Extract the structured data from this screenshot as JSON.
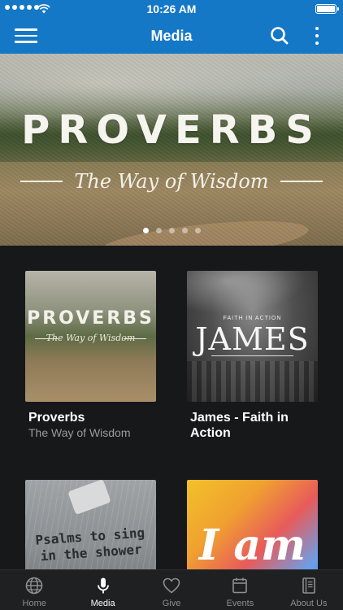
{
  "status_bar": {
    "time": "10:26 AM"
  },
  "app_bar": {
    "title": "Media"
  },
  "hero": {
    "title": "PROVERBS",
    "subtitle": "The Way of Wisdom",
    "carousel_pages": 5,
    "active_page": 1
  },
  "media": [
    {
      "title": "Proverbs",
      "subtitle": "The Way of Wisdom",
      "art_title": "PROVERBS",
      "art_subtitle": "The Way of Wisdom"
    },
    {
      "title": "James - Faith in Action",
      "subtitle": "",
      "art_small": "FAITH IN ACTION",
      "art_title": "JAMES"
    },
    {
      "title": "",
      "subtitle": "",
      "art_title": "Psalms to sing in the shower"
    },
    {
      "title": "",
      "subtitle": "",
      "art_title": "I am"
    }
  ],
  "tab_bar": {
    "tabs": [
      {
        "label": "Home",
        "icon": "globe-icon"
      },
      {
        "label": "Media",
        "icon": "microphone-icon",
        "active": true
      },
      {
        "label": "Give",
        "icon": "heart-icon"
      },
      {
        "label": "Events",
        "icon": "calendar-icon"
      },
      {
        "label": "About Us",
        "icon": "book-icon"
      }
    ]
  },
  "colors": {
    "brand_blue": "#1578c6",
    "background": "#17181a",
    "tab_bar": "#1f2022",
    "muted_text": "#9a9ba0"
  }
}
